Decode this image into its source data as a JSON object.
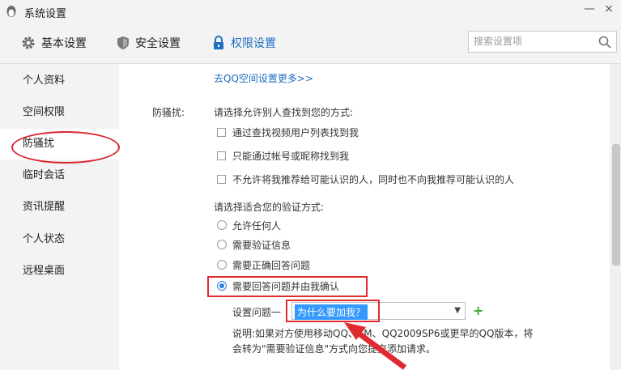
{
  "window": {
    "title": "系统设置",
    "minimize": "—",
    "close": "×"
  },
  "tabs": [
    {
      "label": "基本设置",
      "icon": "gear-icon"
    },
    {
      "label": "安全设置",
      "icon": "shield-icon"
    },
    {
      "label": "权限设置",
      "icon": "lock-icon"
    }
  ],
  "search": {
    "placeholder": "搜索设置项"
  },
  "sidebar": {
    "items": [
      {
        "label": "个人资料"
      },
      {
        "label": "空间权限"
      },
      {
        "label": "防骚扰"
      },
      {
        "label": "临时会话"
      },
      {
        "label": "资讯提醒"
      },
      {
        "label": "个人状态"
      },
      {
        "label": "远程桌面"
      }
    ],
    "active_index": 2
  },
  "content": {
    "more_link": "去QQ空间设置更多>>",
    "field_label": "防骚扰:",
    "find_question": "请选择允许别人查找到您的方式:",
    "find_options": [
      {
        "label": "通过查找视频用户列表找到我",
        "checked": false
      },
      {
        "label": "只能通过帐号或昵称找到我",
        "checked": false
      },
      {
        "label": "不允许将我推荐给可能认识的人，同时也不向我推荐可能认识的人",
        "checked": false
      }
    ],
    "verify_question": "请选择适合您的验证方式:",
    "verify_options": [
      {
        "label": "允许任何人",
        "selected": false
      },
      {
        "label": "需要验证信息",
        "selected": false
      },
      {
        "label": "需要正确回答问题",
        "selected": false
      },
      {
        "label": "需要回答问题并由我确认",
        "selected": true
      }
    ],
    "question_label": "设置问题一",
    "question_value": "为什么要加我？",
    "add_symbol": "+",
    "note_line1": "说明:如果对方使用移动QQ、TM、QQ2009SP6或更早的QQ版本，将",
    "note_line2": "会转为\"需要验证信息\"方式向您提交添加请求。"
  },
  "colors": {
    "accent": "#1e6fc0",
    "annotation": "#e12a2f",
    "radio": "#2b7de0",
    "add": "#3aa63a"
  }
}
